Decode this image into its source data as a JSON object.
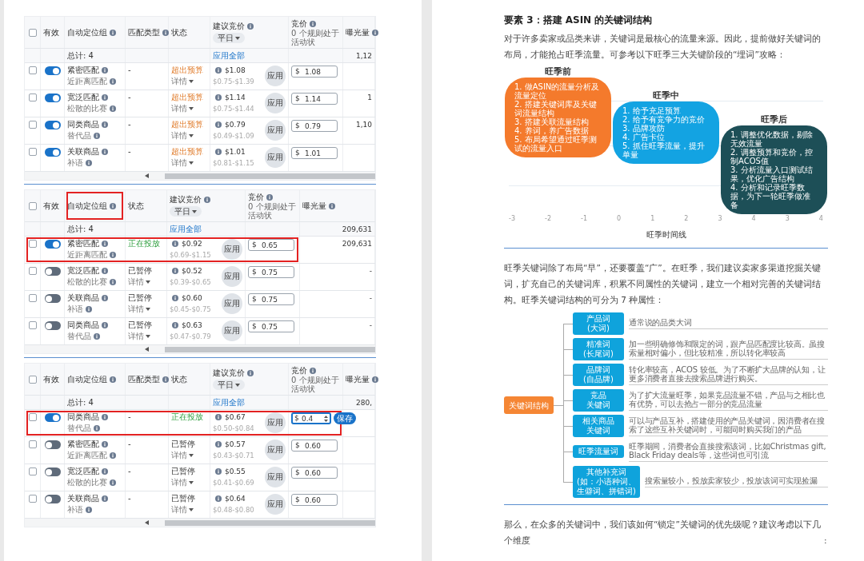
{
  "tables": [
    {
      "select_all_checked": false,
      "columns": [
        {
          "kind": "valid",
          "label": "有效",
          "info": false,
          "highlighted": false
        },
        {
          "kind": "group",
          "label": "自动定位组",
          "info": true,
          "highlighted": false
        },
        {
          "kind": "match",
          "label": "匹配类型",
          "info": true,
          "highlighted": false
        },
        {
          "kind": "status",
          "label": "状态",
          "info": false,
          "highlighted": false
        },
        {
          "kind": "suggested",
          "label": "建议竞价",
          "info": true,
          "highlighted": false,
          "dropdown": "平日"
        },
        {
          "kind": "bid",
          "label": "竞价",
          "info": true,
          "highlighted": false,
          "note": "0 个规则处于活动状"
        },
        {
          "kind": "impressions",
          "label": "曝光量",
          "info": true,
          "highlighted": false
        }
      ],
      "summary": {
        "total": "总计: 4",
        "apply_all": "应用全部",
        "impressions": "1,12"
      },
      "rows": [
        {
          "checked": false,
          "enabled": true,
          "highlighted": false,
          "editing": false,
          "name": "紧密匹配",
          "sub": "近距离匹配",
          "match": "-",
          "status": {
            "text": "超出预算",
            "kind": "overbudget"
          },
          "details": "详情",
          "suggested": "$1.08",
          "range": "$0.75-$1.39",
          "apply": "应用",
          "currency": "$",
          "bid": "1.08"
        },
        {
          "checked": false,
          "enabled": true,
          "highlighted": false,
          "editing": false,
          "name": "宽泛匹配",
          "sub": "松散的比赛",
          "match": "-",
          "status": {
            "text": "超出预算",
            "kind": "overbudget"
          },
          "details": "详情",
          "suggested": "$1.14",
          "range": "$0.75-$1.44",
          "apply": "应用",
          "currency": "$",
          "bid": "1.14",
          "impressions": "1"
        },
        {
          "checked": false,
          "enabled": true,
          "highlighted": false,
          "editing": false,
          "name": "同类商品",
          "sub": "替代品",
          "match": "-",
          "status": {
            "text": "超出预算",
            "kind": "overbudget"
          },
          "details": "详情",
          "suggested": "$0.79",
          "range": "$0.49-$1.09",
          "apply": "应用",
          "currency": "$",
          "bid": "0.79",
          "impressions": "1,10"
        },
        {
          "checked": false,
          "enabled": true,
          "highlighted": false,
          "editing": false,
          "name": "关联商品",
          "sub": "补语",
          "match": "-",
          "status": {
            "text": "超出预算",
            "kind": "overbudget"
          },
          "details": "详情",
          "suggested": "$1.01",
          "range": "$0.81-$1.15",
          "apply": "应用",
          "currency": "$",
          "bid": "1.01"
        }
      ]
    },
    {
      "select_all_checked": false,
      "columns": [
        {
          "kind": "valid",
          "label": "有效",
          "info": false,
          "highlighted": false
        },
        {
          "kind": "group",
          "label": "自动定位组",
          "info": true,
          "highlighted": true
        },
        {
          "kind": "status",
          "label": "状态",
          "info": false,
          "highlighted": false
        },
        {
          "kind": "suggested",
          "label": "建议竞价",
          "info": true,
          "highlighted": false,
          "dropdown": "平日"
        },
        {
          "kind": "bid",
          "label": "竞价",
          "info": true,
          "highlighted": false,
          "note": "0 个规则处于活动状"
        },
        {
          "kind": "impressions",
          "label": "曝光量",
          "info": true,
          "highlighted": false
        }
      ],
      "summary": {
        "total": "总计: 4",
        "apply_all": "应用全部",
        "impressions": "209,631"
      },
      "rows": [
        {
          "checked": false,
          "enabled": true,
          "highlighted": true,
          "editing": false,
          "name": "紧密匹配",
          "sub": "近距离匹配",
          "status": {
            "text": "正在投放",
            "kind": "running"
          },
          "suggested": "$0.92",
          "range": "$0.69-$1.15",
          "apply": "应用",
          "currency": "$",
          "bid": "0.65",
          "impressions": "209,631"
        },
        {
          "checked": false,
          "enabled": false,
          "highlighted": false,
          "editing": false,
          "name": "宽泛匹配",
          "sub": "松散的比赛",
          "status": {
            "text": "已暂停",
            "kind": "paused"
          },
          "details": "详情",
          "suggested": "$0.52",
          "range": "$0.39-$0.65",
          "apply": "应用",
          "currency": "$",
          "bid": "0.75",
          "impressions": "-"
        },
        {
          "checked": false,
          "enabled": false,
          "highlighted": false,
          "editing": false,
          "name": "关联商品",
          "sub": "补语",
          "status": {
            "text": "已暂停",
            "kind": "paused"
          },
          "details": "详情",
          "suggested": "$0.60",
          "range": "$0.45-$0.75",
          "apply": "应用",
          "currency": "$",
          "bid": "0.75",
          "impressions": "-"
        },
        {
          "checked": false,
          "enabled": false,
          "highlighted": false,
          "editing": false,
          "name": "同类商品",
          "sub": "替代品",
          "status": {
            "text": "已暂停",
            "kind": "paused"
          },
          "details": "详情",
          "suggested": "$0.63",
          "range": "$0.47-$0.79",
          "apply": "应用",
          "currency": "$",
          "bid": "0.75",
          "impressions": "-"
        }
      ]
    },
    {
      "select_all_checked": false,
      "columns": [
        {
          "kind": "valid",
          "label": "有效",
          "info": false,
          "highlighted": false
        },
        {
          "kind": "group",
          "label": "自动定位组",
          "info": true,
          "highlighted": false
        },
        {
          "kind": "match",
          "label": "匹配类型",
          "info": true,
          "highlighted": false
        },
        {
          "kind": "status",
          "label": "状态",
          "info": false,
          "highlighted": false
        },
        {
          "kind": "suggested",
          "label": "建议竞价",
          "info": true,
          "highlighted": false,
          "dropdown": "平日"
        },
        {
          "kind": "bid",
          "label": "竞价",
          "info": true,
          "highlighted": false,
          "note": "0 个规则处于活动状"
        },
        {
          "kind": "impressions",
          "label": "曝光量",
          "info": true,
          "highlighted": false
        }
      ],
      "summary": {
        "total": "总计: 4",
        "apply_all": "应用全部",
        "impressions": "280,"
      },
      "rows": [
        {
          "checked": false,
          "enabled": true,
          "highlighted": true,
          "editing": true,
          "name": "同类商品",
          "sub": "替代品",
          "match": "-",
          "status": {
            "text": "正在投放",
            "kind": "running"
          },
          "suggested": "$0.67",
          "range": "$0.50-$0.84",
          "apply": "应用",
          "currency": "$",
          "bid": "0.4",
          "save": "保存"
        },
        {
          "checked": false,
          "enabled": false,
          "highlighted": false,
          "editing": false,
          "name": "紧密匹配",
          "sub": "近距离匹配",
          "match": "-",
          "status": {
            "text": "已暂停",
            "kind": "paused"
          },
          "details": "详情",
          "suggested": "$0.57",
          "range": "$0.43-$0.71",
          "apply": "应用",
          "currency": "$",
          "bid": "0.60"
        },
        {
          "checked": false,
          "enabled": false,
          "highlighted": false,
          "editing": false,
          "name": "宽泛匹配",
          "sub": "松散的比赛",
          "match": "-",
          "status": {
            "text": "已暂停",
            "kind": "paused"
          },
          "details": "详情",
          "suggested": "$0.55",
          "range": "$0.41-$0.69",
          "apply": "应用",
          "currency": "$",
          "bid": "0.60"
        },
        {
          "checked": false,
          "enabled": false,
          "highlighted": false,
          "editing": false,
          "name": "关联商品",
          "sub": "补语",
          "match": "-",
          "status": {
            "text": "已暂停",
            "kind": "paused"
          },
          "details": "详情",
          "suggested": "$0.64",
          "range": "$0.48-$0.80",
          "apply": "应用",
          "currency": "$",
          "bid": "0.60"
        }
      ]
    }
  ],
  "article": {
    "heading": "要素 3：搭建 ASIN 的关键词结构",
    "intro": "对于许多卖家或品类来讲，关键词是最核心的流量来源。因此，提前做好关键词的布局，才能抢占旺季流量。可参考以下旺季三大关键阶段的“埋词”攻略：",
    "timeline": {
      "phases": [
        {
          "title": "旺季前",
          "color": "#f47a2c",
          "items": [
            "1. 做ASIN的流量分析及流量定位",
            "2. 搭建关键词库及关键词流量结构",
            "3. 搭建关联流量结构",
            "4. 养词，养广告数据",
            "5. 布局希望通过旺季测试的流量入口"
          ]
        },
        {
          "title": "旺季中",
          "color": "#13a3e2",
          "items": [
            "1. 给予充足预算",
            "2. 给予有竞争力的竞价",
            "3. 品牌攻防",
            "4. 广告卡位",
            "5. 抓住旺季流量，提升单量"
          ]
        },
        {
          "title": "旺季后",
          "color": "#1d4f57",
          "items": [
            "1. 调整优化数据，剔除无效流量",
            "2. 调整预算和竞价，控制ACOS值",
            "3. 分析流量入口测试结果，优化广告结构",
            "4. 分析和记录旺季数据，为下一轮旺季做准备"
          ]
        }
      ],
      "axis_labels": [
        "-3",
        "-2",
        "-1",
        "0",
        "1",
        "2",
        "3",
        "4",
        "3",
        "4"
      ],
      "axis_title": "旺季时间线"
    },
    "body": "旺季关键词除了布局“早”，还要覆盖“广”。在旺季，我们建议卖家多渠道挖掘关键词，扩充自己的关键词库，积累不同属性的关键词，建立一个相对完善的关键词结构。旺季关键词结构的可分为 7 种属性：",
    "mindmap": {
      "root": "关键词结构",
      "branches": [
        {
          "label": [
            "产品词",
            "(大词)"
          ],
          "description": "通常说的品类大词"
        },
        {
          "label": [
            "精准词",
            "(长尾词)"
          ],
          "description": "加一些明确修饰和限定的词，跟产品匹配度比较高。虽搜索量相对偏小，但比较精准，所以转化率较高"
        },
        {
          "label": [
            "品牌词",
            "(自品牌)"
          ],
          "description": "转化率较高，ACOS 较低。为了不断扩大品牌的认知，让更多消费者直接去搜索品牌进行购买。"
        },
        {
          "label": [
            "竞品",
            "关键词"
          ],
          "description": "为了扩大流量旺季，如果竞品流量不错，产品与之相比也有优势，可以去抢占一部分的竞品流量"
        },
        {
          "label": [
            "相关商品",
            "关键词"
          ],
          "description": "可以与产品互补，搭建使用的产品关键词，因消费者在搜索了这些互补关键词时，可能同时购买我们的产品"
        },
        {
          "label": [
            "旺季流量词"
          ],
          "description": "旺季期间，消费者会直接搜索该词，比如Christmas gift, Black Friday deals等，这些词也可引流"
        },
        {
          "label": [
            "其他补充词",
            "(如：小语种词、",
            "生僻词、拼错词)"
          ],
          "description": "搜索量较小，投放卖家较少，投放该词可实现捡漏"
        }
      ]
    },
    "closing": "那么，在众多的关键词中，我们该如何“锁定”关键词的优先级呢？建议考虑以下几个维度",
    "closing_colon": ":"
  }
}
